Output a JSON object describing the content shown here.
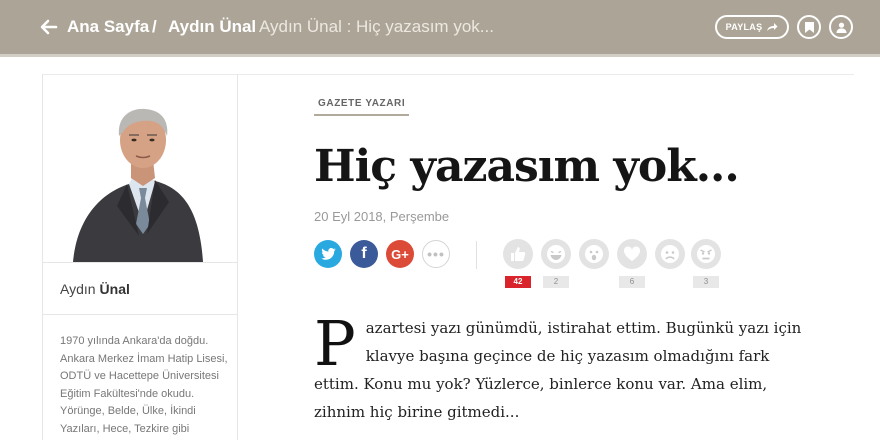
{
  "header": {
    "home": "Ana Sayfa",
    "separator": "/",
    "author": "Aydın Ünal",
    "current": "Aydın Ünal : Hiç yazasım yok...",
    "share_label": "PAYLAŞ",
    "icons": [
      "back-arrow-icon",
      "share-arrow-icon",
      "bookmark-icon",
      "user-icon"
    ],
    "bar_color": "#aca597"
  },
  "author": {
    "first_name": "Aydın",
    "last_name": "Ünal",
    "bio": "1970 yılında Ankara'da doğdu. Ankara Merkez İmam Hatip Lisesi, ODTÜ ve Hacettepe Üniversitesi Eğitim Fakültesi'nde okudu. Yörünge, Belde, Ülke, İkindi Yazıları, Hece, Tezkire gibi"
  },
  "article": {
    "category": "GAZETE YAZARI",
    "title": "Hiç yazasım yok...",
    "date": "20 Eyl 2018, Perşembe",
    "drop_cap": "P",
    "body": "azartesi yazı günümdü, istirahat ettim. Bugünkü yazı için klavye başına geçince de hiç yazasım olmadığını fark ettim. Konu mu yok? Yüzlerce, binlerce konu var. Ama elim, zihnim hiç birine gitmedi..."
  },
  "social": {
    "twitter": "twitter-icon",
    "facebook": "f",
    "google": "G+",
    "more": "•••"
  },
  "reactions": [
    {
      "icon": "thumbs-up-icon",
      "count": "42"
    },
    {
      "icon": "laugh-face-icon",
      "count": "2"
    },
    {
      "icon": "surprised-face-icon",
      "count": ""
    },
    {
      "icon": "heart-icon",
      "count": "6"
    },
    {
      "icon": "sad-face-icon",
      "count": ""
    },
    {
      "icon": "angry-face-icon",
      "count": "3"
    }
  ],
  "colors": {
    "accent_red": "#d9242b",
    "twitter": "#29a9e0",
    "facebook": "#3b5a99",
    "google": "#dc4a38"
  }
}
